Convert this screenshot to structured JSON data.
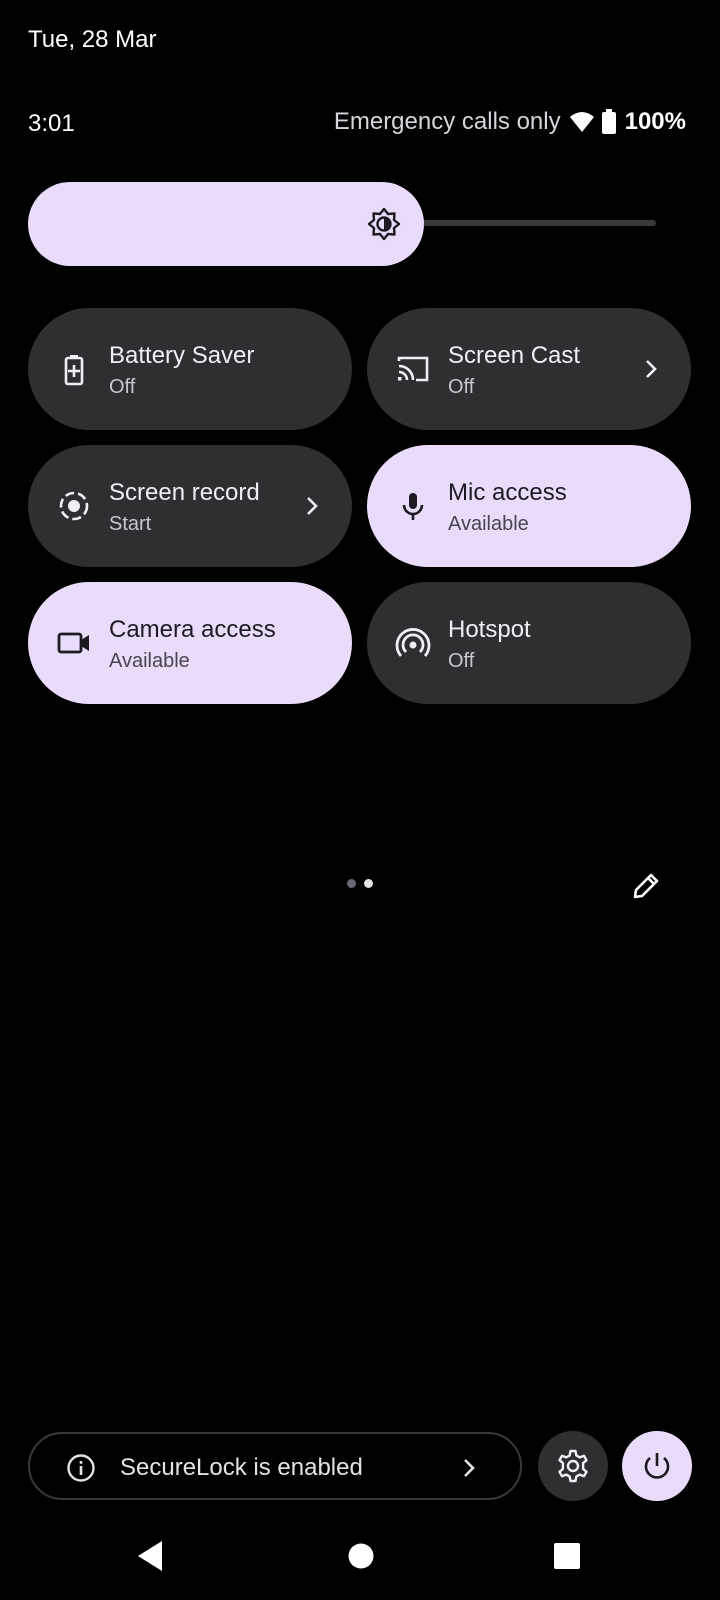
{
  "header": {
    "date": "Tue, 28 Mar",
    "time": "3:01",
    "carrier_status": "Emergency calls only",
    "battery_percent": "100%"
  },
  "brightness": {
    "level": 0.63
  },
  "tiles": [
    {
      "title": "Battery Saver",
      "subtitle": "Off",
      "active": false,
      "icon": "battery-saver-icon",
      "chevron": false
    },
    {
      "title": "Screen Cast",
      "subtitle": "Off",
      "active": false,
      "icon": "cast-icon",
      "chevron": true
    },
    {
      "title": "Screen record",
      "subtitle": "Start",
      "active": false,
      "icon": "screen-record-icon",
      "chevron": true
    },
    {
      "title": "Mic access",
      "subtitle": "Available",
      "active": true,
      "icon": "microphone-icon",
      "chevron": false
    },
    {
      "title": "Camera access",
      "subtitle": "Available",
      "active": true,
      "icon": "camera-icon",
      "chevron": false
    },
    {
      "title": "Hotspot",
      "subtitle": "Off",
      "active": false,
      "icon": "hotspot-icon",
      "chevron": false
    }
  ],
  "pager": {
    "pages": 2,
    "current": 2
  },
  "footer": {
    "secure_label": "SecureLock is enabled"
  },
  "colors": {
    "accent": "#e9dcfb",
    "tile_inactive": "#2f2e31",
    "background": "#000000"
  }
}
